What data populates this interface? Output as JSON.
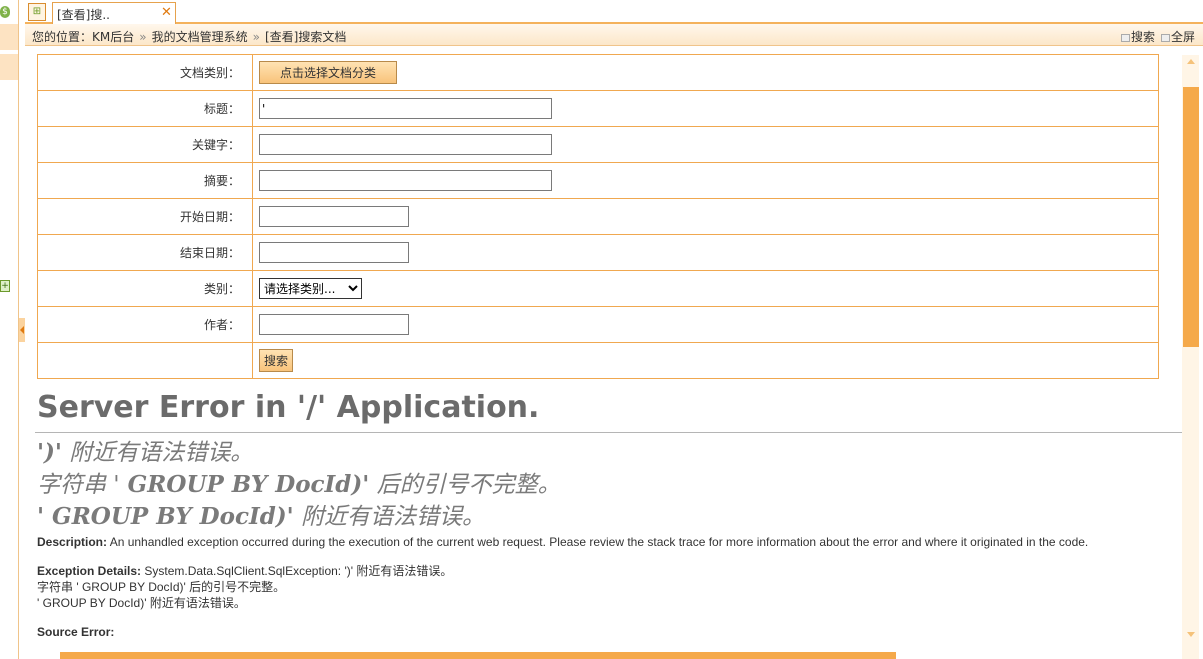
{
  "tab": {
    "label": "[查看]搜..",
    "close": "✕"
  },
  "breadcrumb": {
    "prefix": "您的位置：",
    "items": [
      "KM后台",
      "我的文档管理系统",
      "[查看]搜索文档"
    ],
    "sep": "»"
  },
  "toolbar": {
    "search_label": "搜索",
    "fullscreen_label": "全屏"
  },
  "form": {
    "doc_category_label": "文档类别：",
    "doc_category_button": "点击选择文档分类",
    "title_label": "标题：",
    "title_value": "'",
    "keywords_label": "关键字：",
    "keywords_value": "",
    "summary_label": "摘要：",
    "summary_value": "",
    "start_date_label": "开始日期：",
    "start_date_value": "",
    "end_date_label": "结束日期：",
    "end_date_value": "",
    "type_label": "类别：",
    "type_selected": "请选择类别...",
    "author_label": "作者：",
    "author_value": "",
    "search_button": "搜索"
  },
  "error": {
    "heading": "Server Error in '/' Application.",
    "line1_code": "')'",
    "line1_text": " 附近有语法错误。",
    "line2_pre": "字符串 '",
    "line2_code": "  GROUP BY DocId)'",
    "line2_text": " 后的引号不完整。",
    "line3_code": "'  GROUP BY DocId)'",
    "line3_text": " 附近有语法错误。",
    "description_label": "Description:",
    "description_text": " An unhandled exception occurred during the execution of the current web request. Please review the stack trace for more information about the error and where it originated in the code.",
    "details_label": "Exception Details:",
    "details_line1": " System.Data.SqlClient.SqlException: ')' 附近有语法错误。",
    "details_line2": "字符串 '  GROUP BY DocId)' 后的引号不完整。",
    "details_line3": "'  GROUP BY DocId)' 附近有语法错误。",
    "source_error_label": "Source Error:"
  },
  "colors": {
    "accent": "#f5a94a",
    "border": "#f0a850",
    "heading_gray": "#6b6b6b"
  }
}
